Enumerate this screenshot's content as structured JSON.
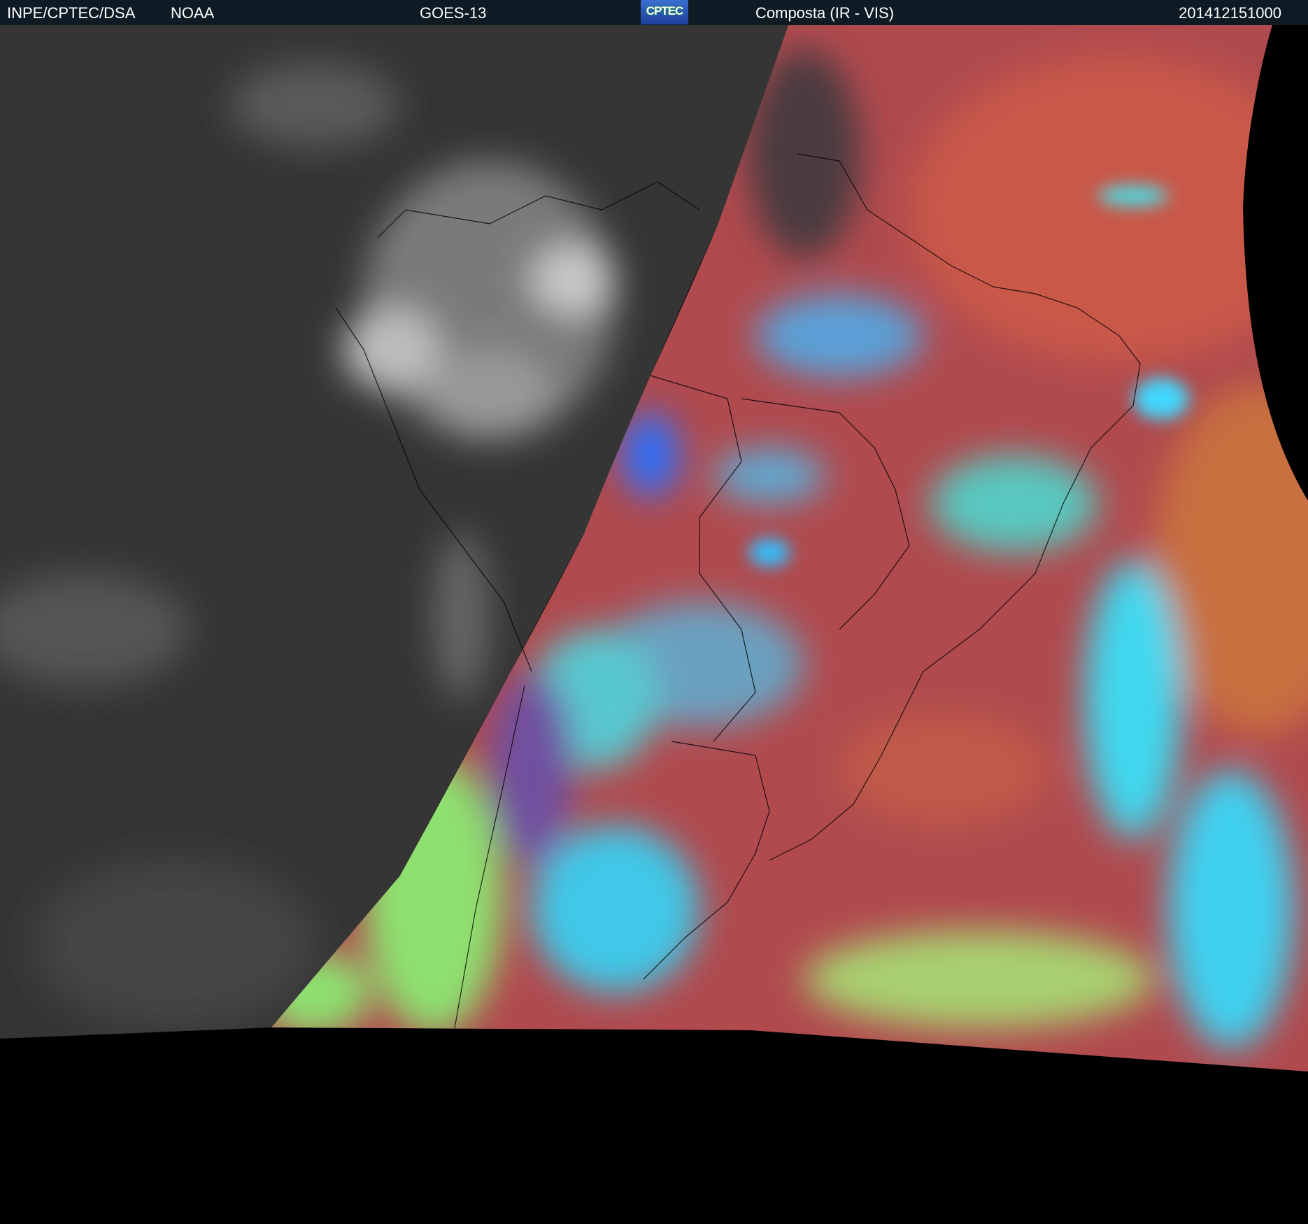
{
  "header": {
    "institution": "INPE/CPTEC/DSA",
    "agency": "NOAA",
    "satellite": "GOES-13",
    "logo_text": "CPTEC",
    "product": "Composta (IR - VIS)",
    "timestamp": "201412151000"
  },
  "colors": {
    "header_bg": "#0f1b24",
    "night_gray": "#3a3a3a",
    "day_red": "#b04a4e",
    "cloud_cyan": "#3ad0e8",
    "cloud_green": "#8ee070"
  }
}
